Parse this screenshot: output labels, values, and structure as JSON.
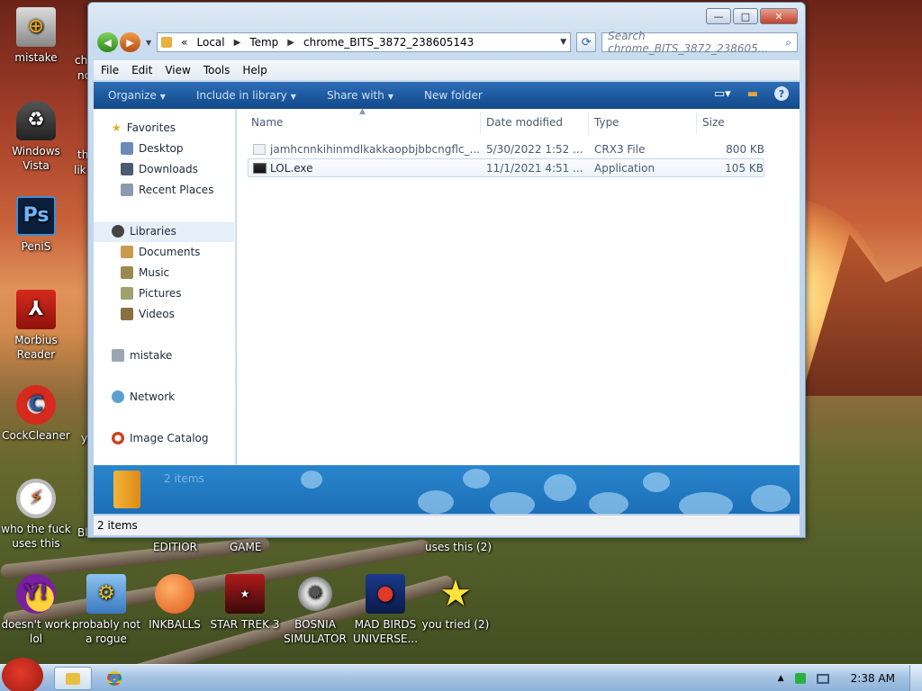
{
  "window": {
    "address": {
      "overflow": "«",
      "segments": [
        "Local",
        "Temp",
        "chrome_BITS_3872_238605143"
      ]
    },
    "search_placeholder": "Search chrome_BITS_3872_238605...",
    "caption": {
      "minimize": "—",
      "maximize": "□",
      "close": "✕"
    }
  },
  "menu": [
    "File",
    "Edit",
    "View",
    "Tools",
    "Help"
  ],
  "commands": {
    "organize": "Organize",
    "include": "Include in library",
    "share": "Share with",
    "new_folder": "New folder"
  },
  "nav": {
    "favorites": "Favorites",
    "desktop": "Desktop",
    "downloads": "Downloads",
    "recent": "Recent Places",
    "libraries": "Libraries",
    "documents": "Documents",
    "music": "Music",
    "pictures": "Pictures",
    "videos": "Videos",
    "homegroup": "mistake",
    "network": "Network",
    "catalog": "Image Catalog"
  },
  "columns": {
    "name": "Name",
    "date": "Date modified",
    "type": "Type",
    "size": "Size"
  },
  "files": [
    {
      "name": "jamhcnnkihinmdlkakkaopbjbbcngflc_...",
      "date": "5/30/2022 1:52 ...",
      "type": "CRX3 File",
      "size": "800 KB"
    },
    {
      "name": "LOL.exe",
      "date": "11/1/2021 4:51 ...",
      "type": "Application",
      "size": "105 KB"
    }
  ],
  "banner_count": "2 items",
  "status": "2 items",
  "desktop": {
    "left_icons": [
      {
        "label": "mistake"
      },
      {
        "label": "Windows Vista"
      },
      {
        "label": "PeniS"
      },
      {
        "label": "Morbius Reader"
      },
      {
        "label": "CockCleaner"
      },
      {
        "label": "who the fuck uses this"
      }
    ],
    "partial_labels": {
      "a": "ch",
      "b": "no",
      "c": "th",
      "d": "lik",
      "e": "y",
      "f": "Bl"
    },
    "top_labels": {
      "editor": "EDITIOR",
      "game": "GAME",
      "uses": "uses this (2)"
    },
    "bottom_icons": [
      {
        "label": "doesn't work lol"
      },
      {
        "label": "probably not a rogue"
      },
      {
        "label": "INKBALLS"
      },
      {
        "label": "STAR TREK 3"
      },
      {
        "label": "BOSNIA SIMULATOR"
      },
      {
        "label": "MAD BIRDS UNIVERSE..."
      },
      {
        "label": "you tried (2)"
      }
    ]
  },
  "taskbar": {
    "clock": "2:38 AM"
  }
}
